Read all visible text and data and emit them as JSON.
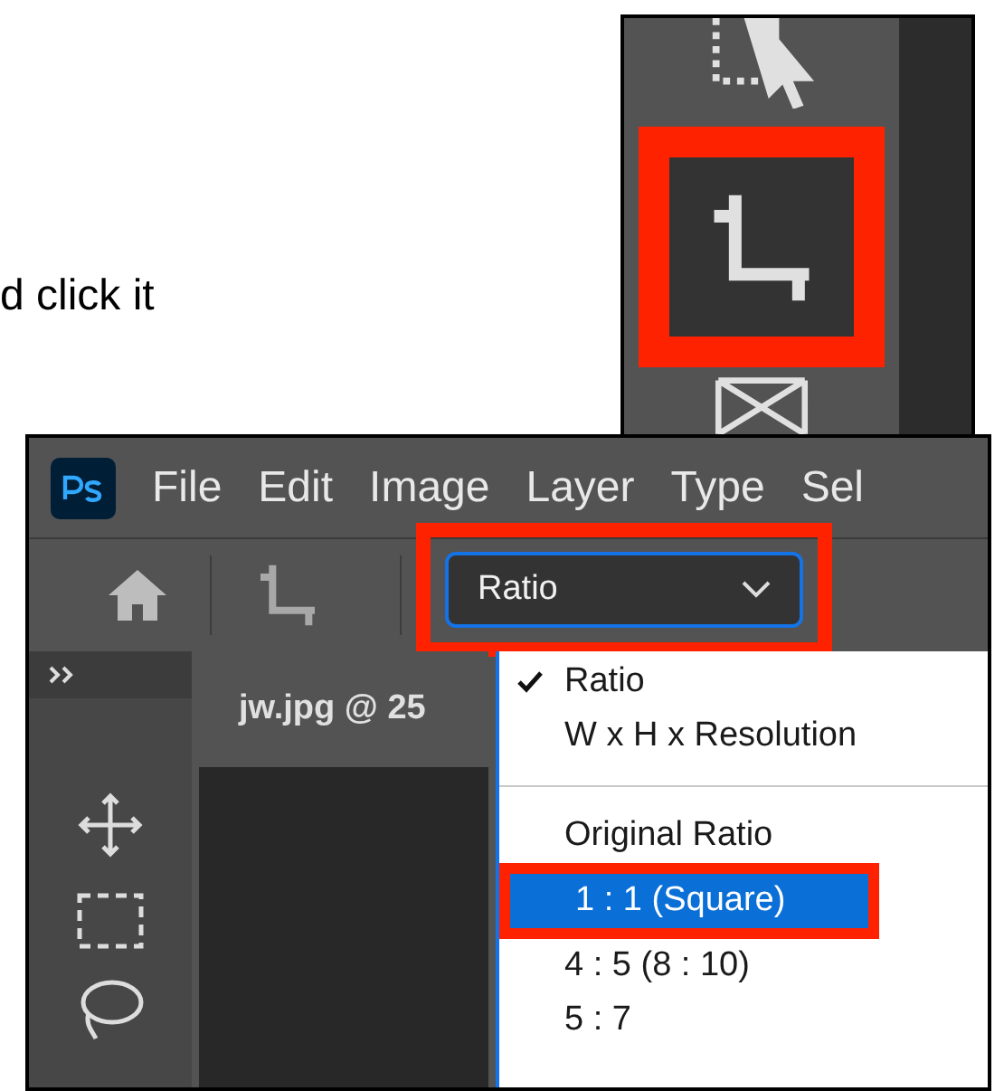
{
  "caption": "d click it",
  "tool_panel": {
    "highlighted": true
  },
  "menu_bar": {
    "items": [
      "File",
      "Edit",
      "Image",
      "Layer",
      "Type",
      "Sel"
    ]
  },
  "options_bar": {
    "ratio_select": {
      "value": "Ratio",
      "highlighted": true
    }
  },
  "document_tab": {
    "title": "jw.jpg @ 25"
  },
  "dropdown": {
    "items": [
      {
        "kind": "option",
        "label": "Ratio",
        "checked": true,
        "selected": false,
        "highlighted": false
      },
      {
        "kind": "option",
        "label": "W x H x Resolution",
        "checked": false,
        "selected": false,
        "highlighted": false
      },
      {
        "kind": "separator"
      },
      {
        "kind": "option",
        "label": "Original Ratio",
        "checked": false,
        "selected": false,
        "highlighted": false
      },
      {
        "kind": "option",
        "label": "1 : 1 (Square)",
        "checked": false,
        "selected": true,
        "highlighted": true
      },
      {
        "kind": "option",
        "label": "4 : 5 (8 : 10)",
        "checked": false,
        "selected": false,
        "highlighted": false
      },
      {
        "kind": "option",
        "label": "5 : 7",
        "checked": false,
        "selected": false,
        "highlighted": false
      }
    ]
  }
}
